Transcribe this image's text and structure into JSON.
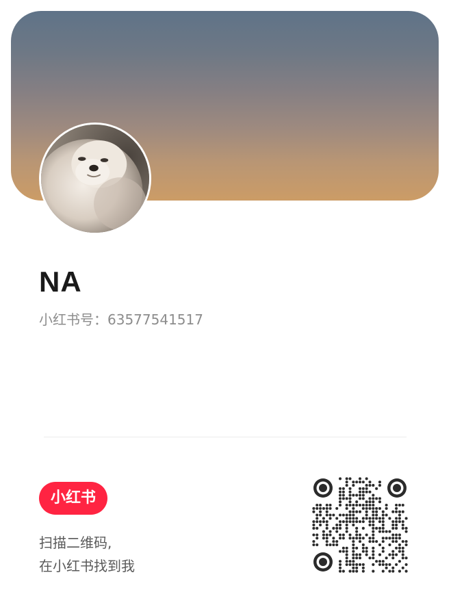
{
  "profile": {
    "name": "NA",
    "account_id": "小红书号：63577541517",
    "avatar_alt": "avatar"
  },
  "brand": {
    "logo_text": "小红书",
    "color": "#ff2442"
  },
  "scan": {
    "line1": "扫描二维码,",
    "line2": "在小红书找到我"
  },
  "colors": {
    "cover_top": "#5f7388",
    "cover_bottom": "#cc9c66",
    "qr": "#2b2b2b"
  }
}
